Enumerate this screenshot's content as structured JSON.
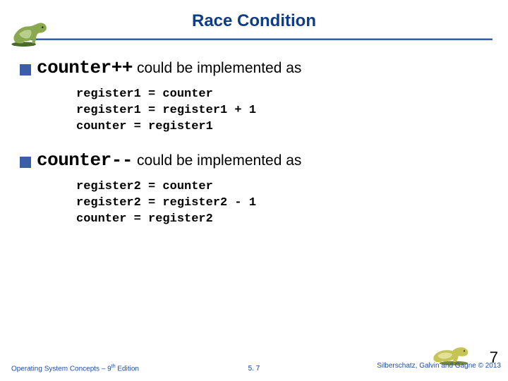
{
  "header": {
    "title": "Race Condition"
  },
  "bullets": {
    "b1": {
      "code": "counter++",
      "text": "could be implemented as"
    },
    "b2": {
      "code": "counter--",
      "text": "could be implemented as"
    }
  },
  "code": {
    "block1": "register1 = counter\nregister1 = register1 + 1\ncounter = register1",
    "block2": "register2 = counter\nregister2 = register2 - 1\ncounter = register2"
  },
  "footer": {
    "left_a": "Operating System Concepts – 9",
    "left_sup": "th",
    "left_b": " Edition",
    "center": "5. 7",
    "right": "Silberschatz, Galvin and Gagne © 2013",
    "pagebig": "7"
  },
  "icons": {
    "dino_tl": "dinosaur-icon",
    "dino_br": "dinosaur-icon"
  }
}
